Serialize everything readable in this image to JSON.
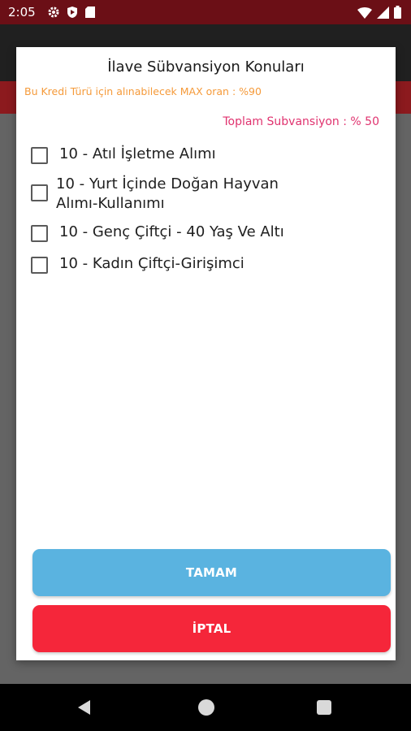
{
  "status_bar": {
    "time": "2:05"
  },
  "dialog": {
    "title": "İlave Sübvansiyon Konuları",
    "max_rate_text": "Bu Kredi Türü için alınabilecek MAX oran : %90",
    "total_text": "Toplam Subvansiyon : % 50",
    "options": [
      {
        "label": "10 - Atıl İşletme Alımı",
        "checked": false
      },
      {
        "label": "10 - Yurt İçinde Doğan Hayvan Alımı-Kullanımı",
        "checked": false
      },
      {
        "label": "10 - Genç Çiftçi - 40 Yaş Ve Altı",
        "checked": false
      },
      {
        "label": "10 - Kadın Çiftçi-Girişimci",
        "checked": false
      }
    ],
    "ok_label": "TAMAM",
    "cancel_label": "İPTAL"
  },
  "colors": {
    "status_bar": "#6b0f16",
    "ok_button": "#5ab3e0",
    "cancel_button": "#f5263a",
    "max_rate_text": "#f59a3a",
    "total_text": "#e0336f"
  }
}
